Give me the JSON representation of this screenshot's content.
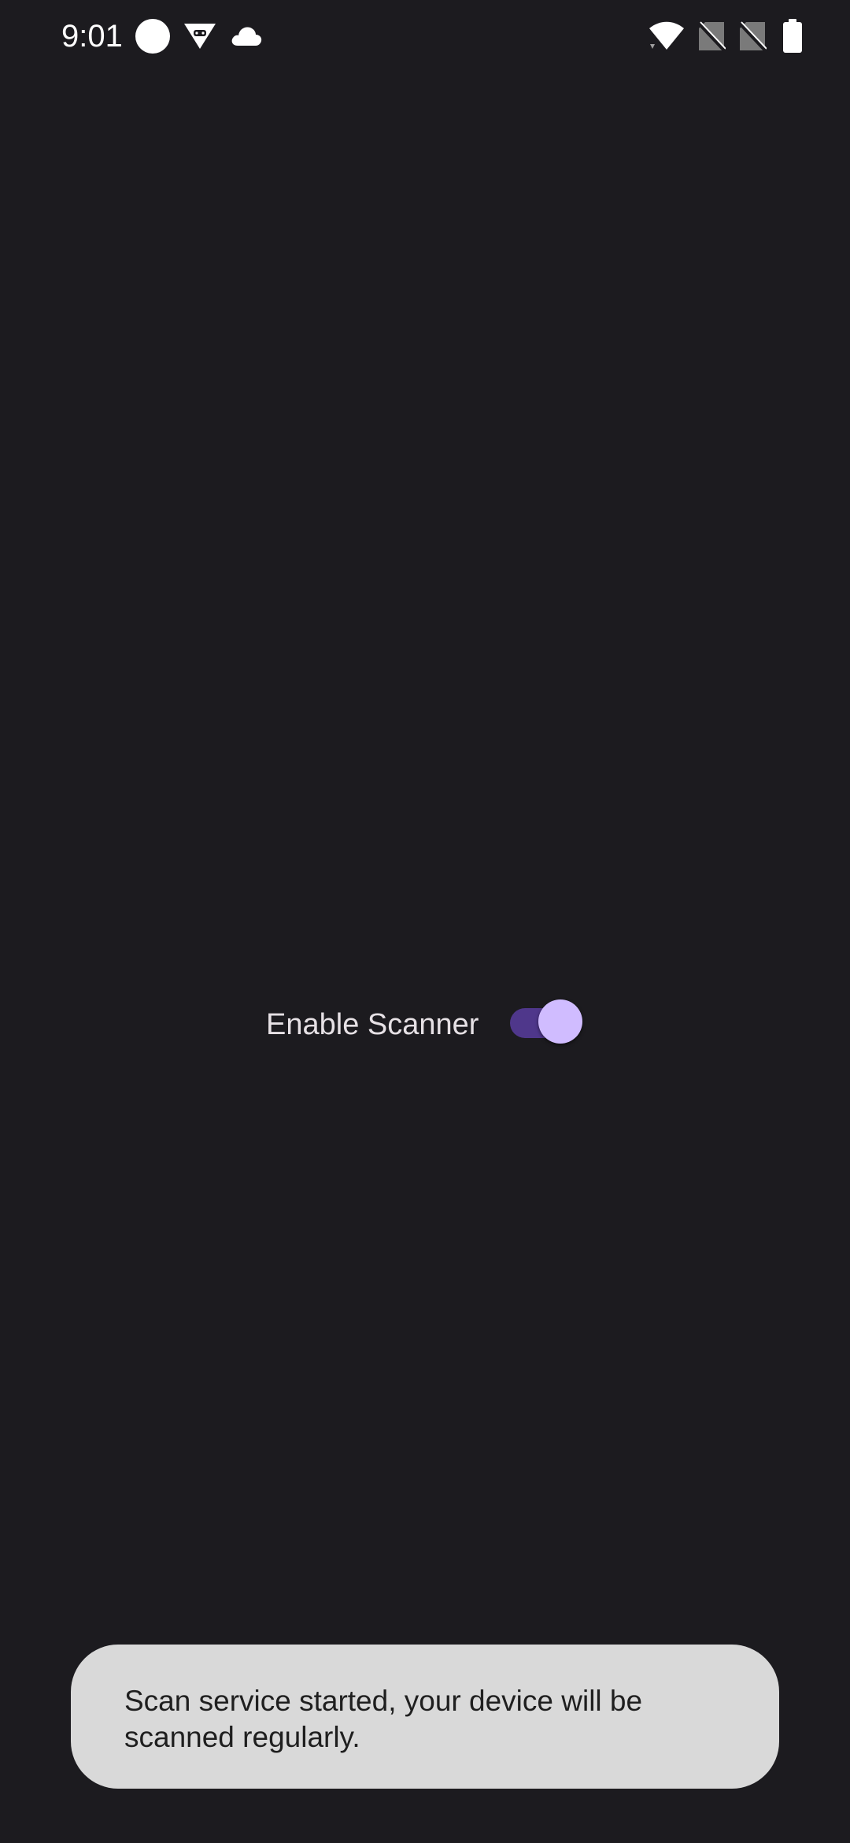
{
  "status_bar": {
    "time": "9:01",
    "icons": [
      "notification-dot-icon",
      "android-debug-icon",
      "cloud-icon",
      "wifi-icon",
      "no-sim-icon",
      "no-sim-icon",
      "battery-icon"
    ]
  },
  "main": {
    "switch_label": "Enable Scanner",
    "switch_checked": true
  },
  "toast": {
    "message": "Scan service started, your device will be scanned regularly."
  },
  "colors": {
    "background": "#1c1b1f",
    "label_text": "#e6e1e5",
    "switch_track_on": "#4f378b",
    "switch_thumb_on": "#d0bcff",
    "toast_background": "#d9d9d9",
    "toast_text": "#1f1f1f"
  }
}
